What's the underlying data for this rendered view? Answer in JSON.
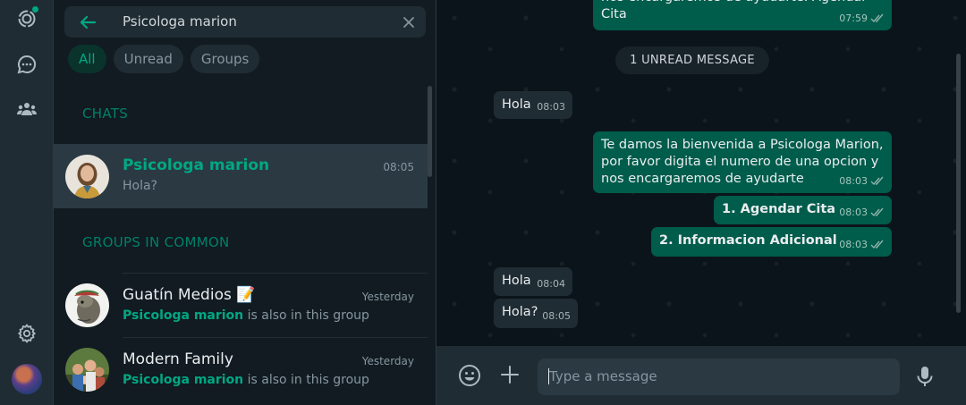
{
  "search": {
    "query": "Psicologa marion"
  },
  "filters": [
    "All",
    "Unread",
    "Groups"
  ],
  "sections": {
    "chats": "CHATS",
    "groups": "GROUPS IN COMMON"
  },
  "chats": [
    {
      "name": "Psicologa marion",
      "time": "08:05",
      "preview": "Hola?"
    }
  ],
  "groups": [
    {
      "name": "Guatín Medios 📝",
      "time": "Yesterday",
      "highlight": "Psicologa marion",
      "rest": " is also in this group"
    },
    {
      "name": "Modern Family",
      "time": "Yesterday",
      "highlight": "Psicologa marion",
      "rest": " is also in this group"
    }
  ],
  "messages": {
    "top_text": "nos encargaremos de ayudarte. Agendar Cita",
    "top_time": "07:59",
    "unread_label": "1 UNREAD MESSAGE",
    "m1_text": "Hola",
    "m1_time": "08:03",
    "m2_text": "Te damos la bienvenida a Psicologa Marion, por favor digita el numero de una opcion y nos encargaremos de ayudarte",
    "m2_time": "08:03",
    "m3_text": "1. Agendar Cita",
    "m3_time": "08:03",
    "m4_text": "2. Informacion Adicional",
    "m4_time": "08:03",
    "m5_text": "Hola",
    "m5_time": "08:04",
    "m6_text": "Hola?",
    "m6_time": "08:05"
  },
  "composer": {
    "placeholder": "Type a message"
  },
  "colors": {
    "accent": "#00a884",
    "outgoing": "#005c4b",
    "incoming": "#202c33",
    "panel": "#202c33",
    "background": "#111b21"
  }
}
